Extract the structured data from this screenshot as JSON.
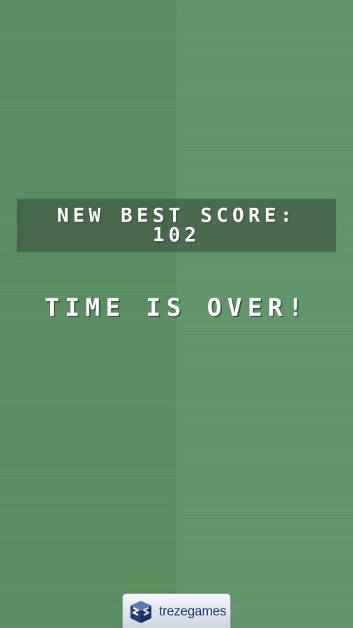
{
  "score_panel": {
    "label": "NEW BEST SCORE:",
    "value": "102"
  },
  "game_message": "TIME IS OVER!",
  "brand": {
    "name": "trezegames",
    "logo_icon": "trezegames-cube-logo-icon",
    "name_color": "#1f3f86"
  },
  "colors": {
    "left_background": "#5c8f62",
    "right_background": "#64976b",
    "text": "#ffffff",
    "panel": "#3c523e"
  }
}
